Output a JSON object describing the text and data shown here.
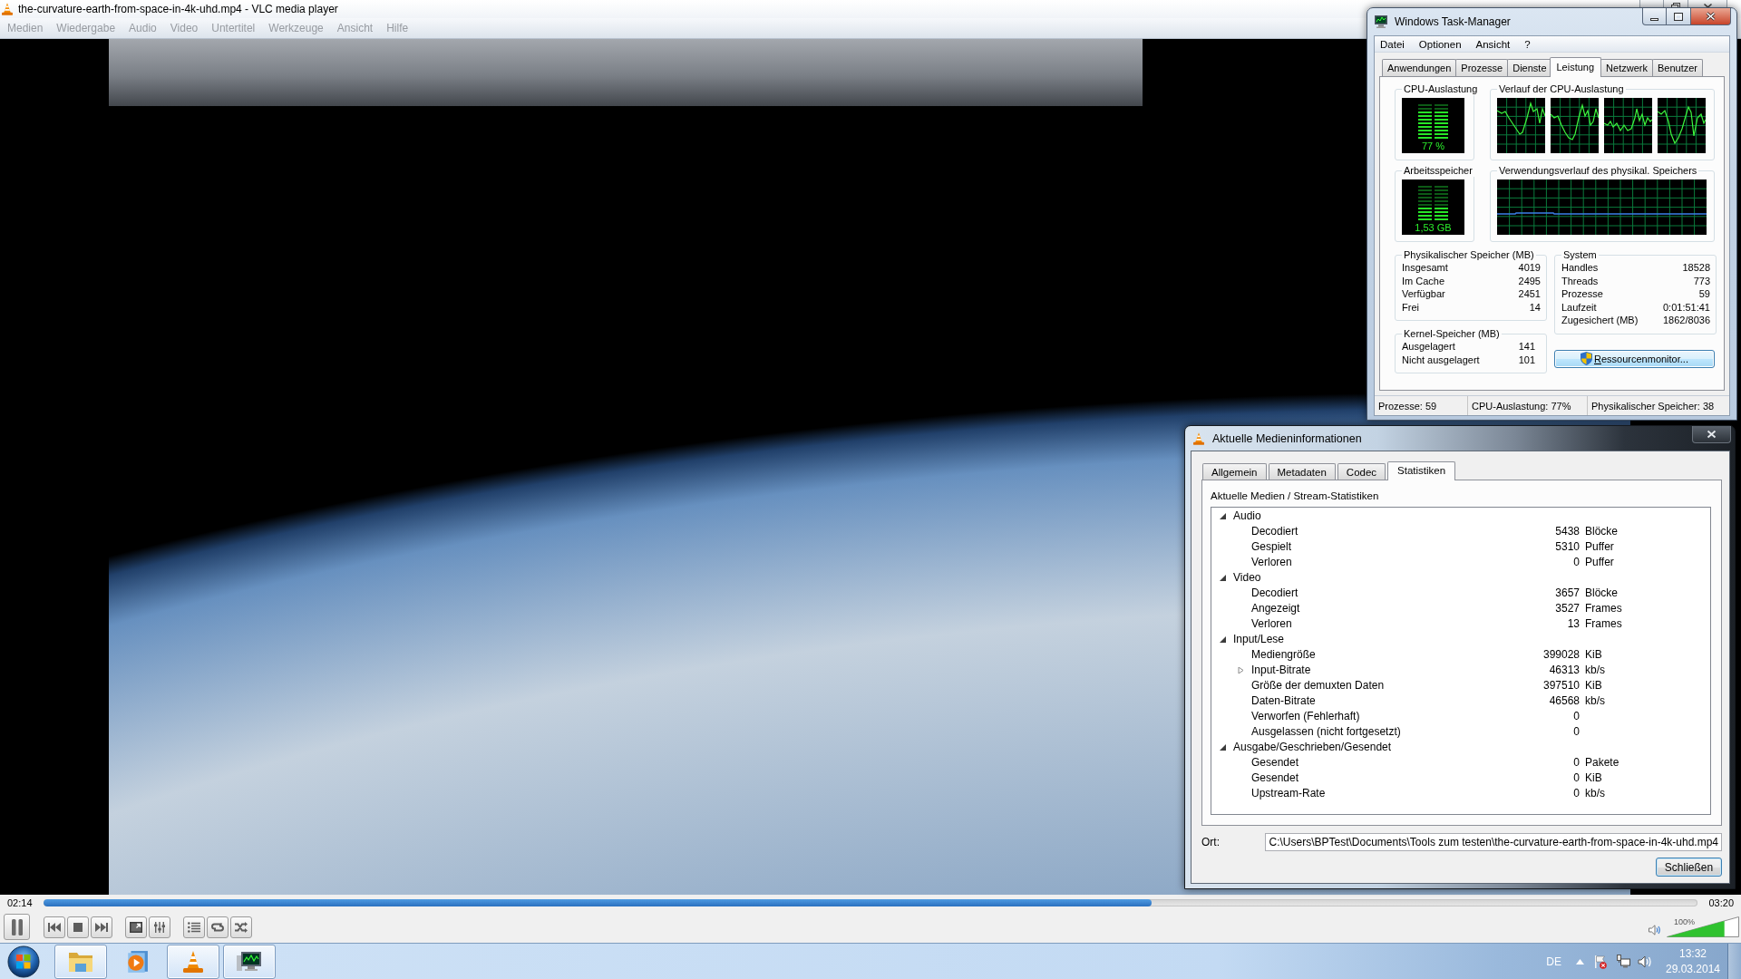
{
  "vlc_window": {
    "title": "the-curvature-earth-from-space-in-4k-uhd.mp4 - VLC media player",
    "menu": [
      "Medien",
      "Wiedergabe",
      "Audio",
      "Video",
      "Untertitel",
      "Werkzeuge",
      "Ansicht",
      "Hilfe"
    ],
    "elapsed": "02:14",
    "duration": "03:20",
    "seek": {
      "level": 0.67
    },
    "volume": {
      "reading": "100%",
      "level": 0.8
    }
  },
  "task_manager": {
    "title": "Windows Task-Manager",
    "menu": [
      "Datei",
      "Optionen",
      "Ansicht",
      "?"
    ],
    "tabs": [
      {
        "label": "Anwendungen",
        "selected": false
      },
      {
        "label": "Prozesse",
        "selected": false
      },
      {
        "label": "Dienste",
        "selected": false
      },
      {
        "label": "Leistung",
        "selected": true
      },
      {
        "label": "Netzwerk",
        "selected": false
      },
      {
        "label": "Benutzer",
        "selected": false
      }
    ],
    "cpu_meter": {
      "title": "CPU-Auslastung",
      "reading": "77 %",
      "level": 0.77
    },
    "cpu_history": {
      "title": "Verlauf der CPU-Auslastung"
    },
    "memory_meter": {
      "title": "Arbeitsspeicher",
      "reading": "1,53 GB",
      "level": 0.38
    },
    "memory_history": {
      "title": "Verwendungsverlauf des physikal. Speichers"
    },
    "physical_memory": {
      "title": "Physikalischer Speicher (MB)",
      "rows": [
        {
          "label": "Insgesamt",
          "value": "4019"
        },
        {
          "label": "Im Cache",
          "value": "2495"
        },
        {
          "label": "Verfügbar",
          "value": "2451"
        },
        {
          "label": "Frei",
          "value": "14"
        }
      ]
    },
    "kernel_memory": {
      "title": "Kernel-Speicher (MB)",
      "rows": [
        {
          "label": "Ausgelagert",
          "value": "141"
        },
        {
          "label": "Nicht ausgelagert",
          "value": "101"
        }
      ]
    },
    "system": {
      "title": "System",
      "rows": [
        {
          "label": "Handles",
          "value": "18528"
        },
        {
          "label": "Threads",
          "value": "773"
        },
        {
          "label": "Prozesse",
          "value": "59"
        },
        {
          "label": "Laufzeit",
          "value": "0:01:51:41"
        },
        {
          "label": "Zugesichert (MB)",
          "value": "1862/8036"
        }
      ]
    },
    "resource_monitor_button": "Ressourcenmonitor...",
    "status_bar": [
      "Prozesse: 59",
      "CPU-Auslastung: 77%",
      "Physikalischer Speicher: 38"
    ]
  },
  "media_info": {
    "title": "Aktuelle Medieninformationen",
    "tabs": [
      {
        "label": "Allgemein",
        "selected": false
      },
      {
        "label": "Metadaten",
        "selected": false
      },
      {
        "label": "Codec",
        "selected": false
      },
      {
        "label": "Statistiken",
        "selected": true
      }
    ],
    "heading": "Aktuelle Medien / Stream-Statistiken",
    "tree": [
      {
        "label": "Audio",
        "kind": "node",
        "expanded": true,
        "children": [
          {
            "label": "Decodiert",
            "kind": "leaf",
            "value": "5438",
            "unit": "Blöcke"
          },
          {
            "label": "Gespielt",
            "kind": "leaf",
            "value": "5310",
            "unit": "Puffer"
          },
          {
            "label": "Verloren",
            "kind": "leaf",
            "value": "0",
            "unit": "Puffer"
          }
        ]
      },
      {
        "label": "Video",
        "kind": "node",
        "expanded": true,
        "children": [
          {
            "label": "Decodiert",
            "kind": "leaf",
            "value": "3657",
            "unit": "Blöcke"
          },
          {
            "label": "Angezeigt",
            "kind": "leaf",
            "value": "3527",
            "unit": "Frames"
          },
          {
            "label": "Verloren",
            "kind": "leaf",
            "value": "13",
            "unit": "Frames"
          }
        ]
      },
      {
        "label": "Input/Lese",
        "kind": "node",
        "expanded": true,
        "children": [
          {
            "label": "Mediengröße",
            "kind": "leaf",
            "value": "399028",
            "unit": "KiB"
          },
          {
            "label": "Input-Bitrate",
            "kind": "node",
            "expanded": false,
            "value": "46313",
            "unit": "kb/s"
          },
          {
            "label": "Größe der demuxten Daten",
            "kind": "leaf",
            "value": "397510",
            "unit": "KiB"
          },
          {
            "label": "Daten-Bitrate",
            "kind": "leaf",
            "value": "46568",
            "unit": "kb/s"
          },
          {
            "label": "Verworfen (Fehlerhaft)",
            "kind": "leaf",
            "value": "0"
          },
          {
            "label": "Ausgelassen (nicht fortgesetzt)",
            "kind": "leaf",
            "value": "0"
          }
        ]
      },
      {
        "label": "Ausgabe/Geschrieben/Gesendet",
        "kind": "node",
        "expanded": true,
        "children": [
          {
            "label": "Gesendet",
            "kind": "leaf",
            "value": "0",
            "unit": "Pakete"
          },
          {
            "label": "Gesendet",
            "kind": "leaf",
            "value": "0",
            "unit": "KiB"
          },
          {
            "label": "Upstream-Rate",
            "kind": "leaf",
            "value": "0",
            "unit": "kb/s"
          }
        ]
      }
    ],
    "location_label": "Ort:",
    "location": "C:\\Users\\BPTest\\Documents\\Tools zum testen\\the-curvature-earth-from-space-in-4k-uhd.mp4",
    "close_button": "Schließen"
  },
  "taskbar": {
    "apps": [
      {
        "kind": "explorer",
        "running": true
      },
      {
        "kind": "player",
        "running": false
      },
      {
        "kind": "vlc",
        "running": true
      },
      {
        "kind": "taskmgr",
        "running": true
      }
    ],
    "language": "DE",
    "time": "13:32",
    "date": "29.03.2014"
  }
}
